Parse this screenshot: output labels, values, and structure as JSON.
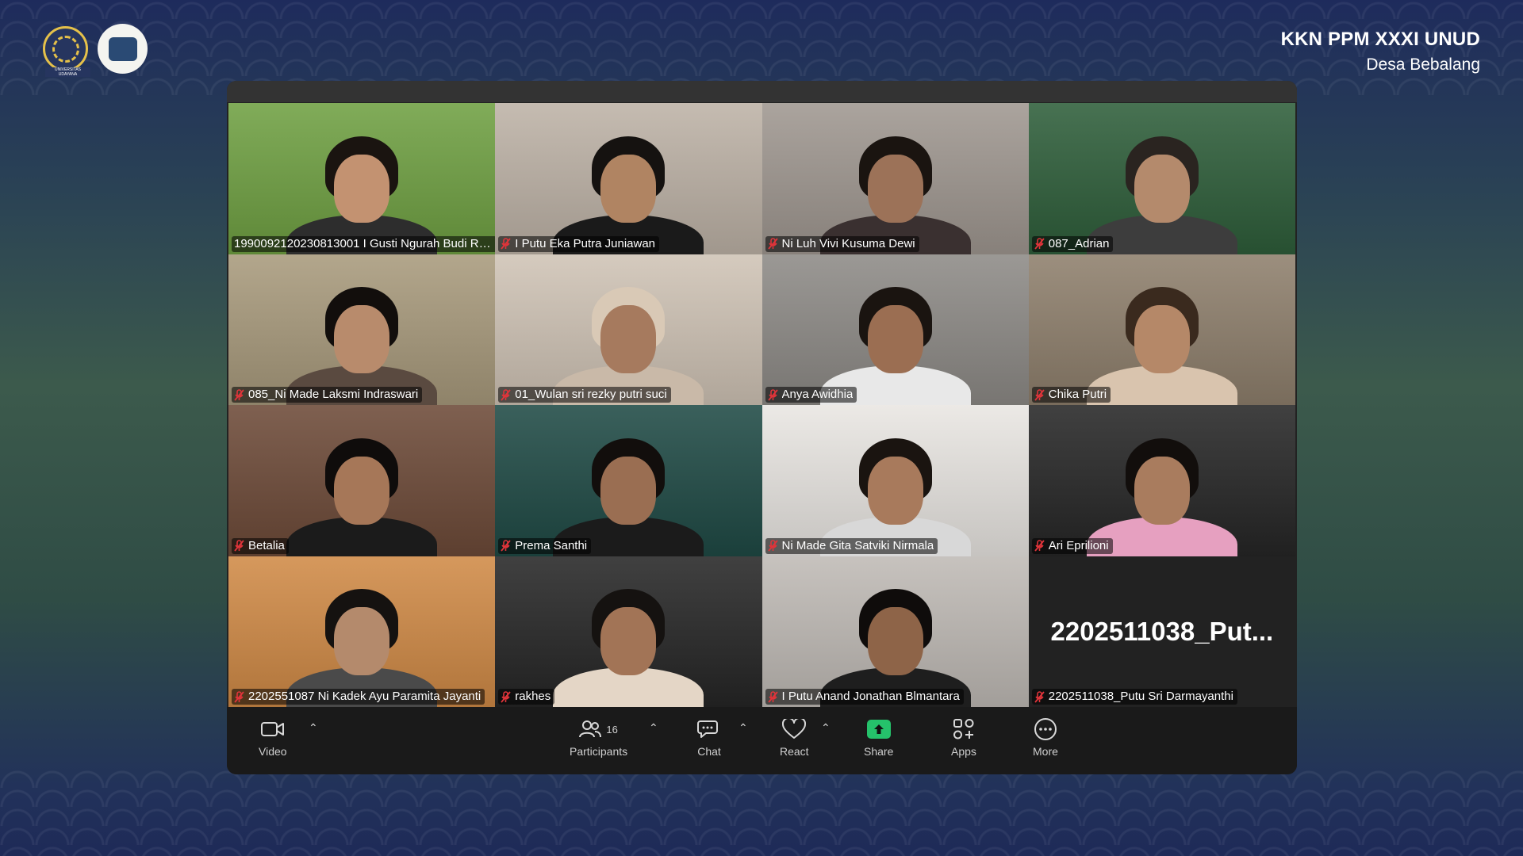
{
  "header": {
    "title": "KKN PPM XXXI UNUD",
    "subtitle": "Desa Bebalang",
    "logo1_text": "UNIVERSITAS UDAYANA"
  },
  "participants": [
    {
      "name": "199009212023081300​1 I Gusti Ngurah Budi Ra...",
      "muted": false,
      "active": true,
      "bg": "#6fa042",
      "shirt": "#2d2d2d",
      "skin": "#c39271",
      "hair": "#1a1410"
    },
    {
      "name": "I Putu Eka Putra Juniawan",
      "muted": true,
      "active": false,
      "bg": "#bdb2a6",
      "shirt": "#1a1a1a",
      "skin": "#b08462",
      "hair": "#151210"
    },
    {
      "name": "Ni Luh Vivi Kusuma Dewi",
      "muted": true,
      "active": false,
      "bg": "#9f9790",
      "shirt": "#3a3030",
      "skin": "#9c7258",
      "hair": "#1a1410"
    },
    {
      "name": "087_Adrian",
      "muted": true,
      "active": false,
      "bg": "#2e5e3a",
      "shirt": "#3d3d3d",
      "skin": "#b48a6c",
      "hair": "#2a2420"
    },
    {
      "name": "085_Ni Made Laksmi Indraswari",
      "muted": true,
      "active": false,
      "bg": "#a89a7c",
      "shirt": "#5a4a40",
      "skin": "#b88b6c",
      "hair": "#120e0c"
    },
    {
      "name": "01_Wulan sri rezky putri suci",
      "muted": true,
      "active": false,
      "bg": "#cfc3b5",
      "shirt": "#c9b9a8",
      "skin": "#a67a5e",
      "hair": "#d9c9b6"
    },
    {
      "name": "Anya Awidhia",
      "muted": true,
      "active": false,
      "bg": "#8d8a86",
      "shirt": "#e8e8e8",
      "skin": "#9b6e52",
      "hair": "#1a1410"
    },
    {
      "name": "Chika Putri",
      "muted": true,
      "active": false,
      "bg": "#8e7f6c",
      "shirt": "#d9c4ae",
      "skin": "#b58868",
      "hair": "#3a2a1e"
    },
    {
      "name": "Betalia",
      "muted": true,
      "active": false,
      "bg": "#6d4a38",
      "shirt": "#1b1b1b",
      "skin": "#a67758",
      "hair": "#0f0c0b"
    },
    {
      "name": "Prema Santhi",
      "muted": true,
      "active": false,
      "bg": "#1f4a45",
      "shirt": "#1b1b1b",
      "skin": "#9a6e52",
      "hair": "#120e0c"
    },
    {
      "name": "Ni Made Gita Satviki Nirmala",
      "muted": true,
      "active": false,
      "bg": "#e9e6e2",
      "shirt": "#d8d8d8",
      "skin": "#a87a5c",
      "hair": "#1a1410"
    },
    {
      "name": "Ari Eprilioni",
      "muted": true,
      "active": false,
      "bg": "#262626",
      "shirt": "#e6a0c0",
      "skin": "#a97c5e",
      "hair": "#120e0c"
    },
    {
      "name": "2202551087 Ni Kadek Ayu Paramita Jayanti",
      "muted": true,
      "active": false,
      "bg": "#d08a46",
      "shirt": "#4a4a4a",
      "skin": "#b48a6c",
      "hair": "#151210"
    },
    {
      "name": "rakhes",
      "muted": true,
      "active": false,
      "bg": "#262626",
      "shirt": "#e4d6c6",
      "skin": "#a27456",
      "hair": "#151210"
    },
    {
      "name": "I Putu Anand Jonathan Blmantara",
      "muted": true,
      "active": false,
      "bg": "#bfbab5",
      "shirt": "#1e1e1e",
      "skin": "#8e6448",
      "hair": "#0f0c0b"
    },
    {
      "name": "2202511038_Putu Sri Darmayanthi",
      "muted": true,
      "active": false,
      "bg": "#222222",
      "big_name": "2202511038_Put...",
      "no_video": true
    }
  ],
  "toolbar": {
    "video": "Video",
    "participants": "Participants",
    "participants_count": "16",
    "chat": "Chat",
    "react": "React",
    "share": "Share",
    "apps": "Apps",
    "more": "More",
    "share_color": "#25c26b",
    "active_border": "#27d17f",
    "muted_color": "#e0343a"
  }
}
